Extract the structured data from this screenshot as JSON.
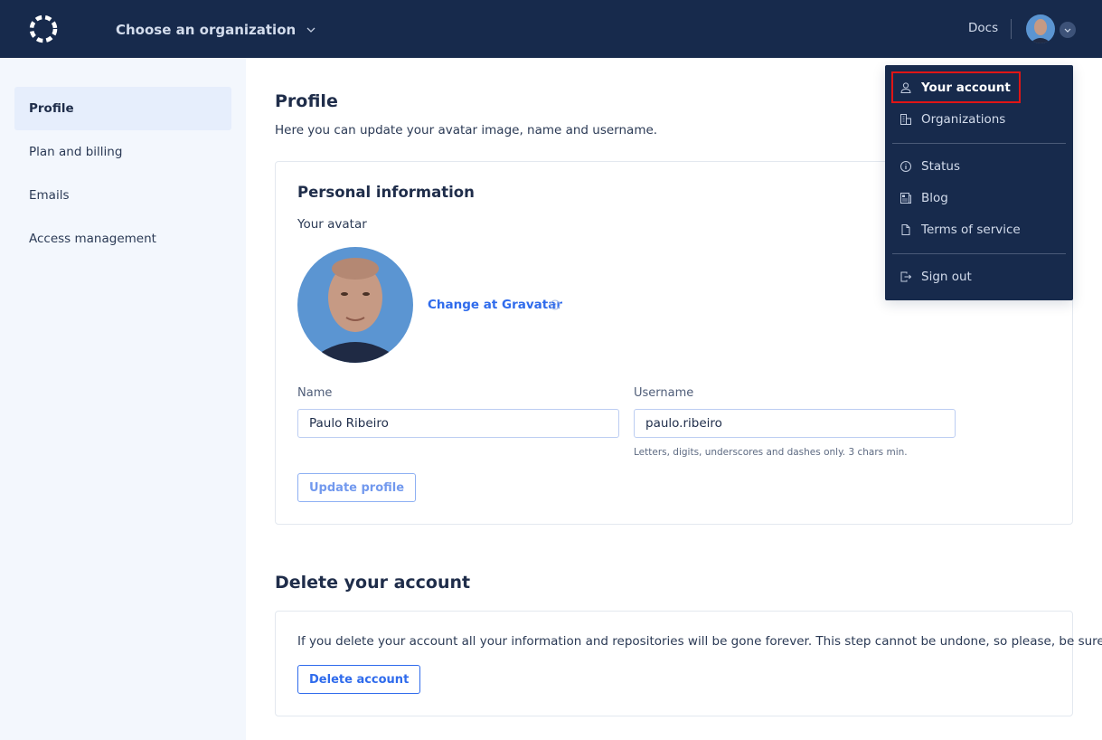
{
  "header": {
    "org_selector_label": "Choose an organization",
    "docs_label": "Docs"
  },
  "sidebar": {
    "items": [
      {
        "label": "Profile",
        "active": true
      },
      {
        "label": "Plan and billing",
        "active": false
      },
      {
        "label": "Emails",
        "active": false
      },
      {
        "label": "Access management",
        "active": false
      }
    ]
  },
  "main": {
    "title": "Profile",
    "subtitle": "Here you can update your avatar image, name and username.",
    "personal": {
      "title": "Personal information",
      "avatar_label": "Your avatar",
      "gravatar_link": "Change at Gravatar",
      "name_label": "Name",
      "name_value": "Paulo Ribeiro",
      "username_label": "Username",
      "username_value": "paulo.ribeiro",
      "username_hint": "Letters, digits, underscores and dashes only. 3 chars min.",
      "update_button": "Update profile"
    },
    "delete": {
      "title": "Delete your account",
      "text": "If you delete your account all your information and repositories will be gone forever. This step cannot be undone, so please, be sure!",
      "button": "Delete account"
    }
  },
  "user_menu": {
    "items": [
      {
        "label": "Your account",
        "icon": "user-icon",
        "selected": true
      },
      {
        "label": "Organizations",
        "icon": "building-icon"
      },
      {
        "label": "Status",
        "icon": "info-icon"
      },
      {
        "label": "Blog",
        "icon": "newspaper-icon"
      },
      {
        "label": "Terms of service",
        "icon": "document-icon"
      },
      {
        "label": "Sign out",
        "icon": "sign-out-icon"
      }
    ]
  },
  "colors": {
    "topbar": "#172a4c",
    "accent": "#2f6bec",
    "sidebar_bg": "#f3f7fd",
    "highlight": "#e01515"
  }
}
